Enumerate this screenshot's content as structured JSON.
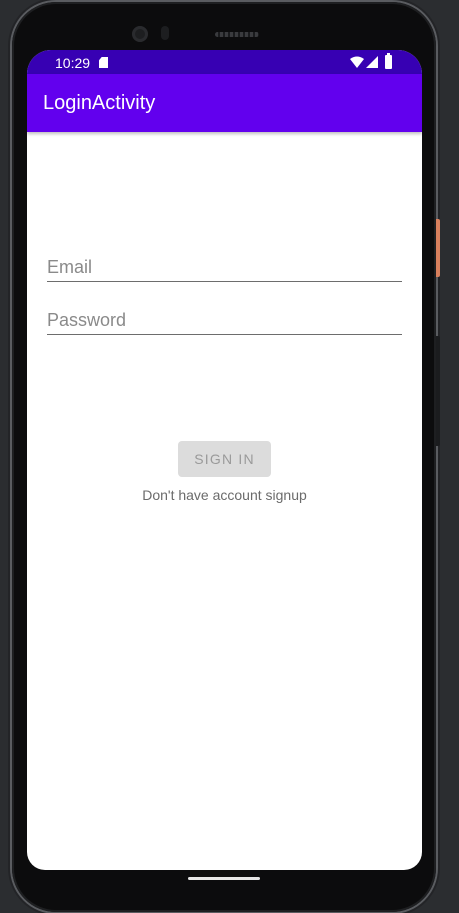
{
  "status_bar": {
    "time": "10:29"
  },
  "app_bar": {
    "title": "LoginActivity"
  },
  "form": {
    "email_placeholder": "Email",
    "email_value": "",
    "password_placeholder": "Password",
    "password_value": "",
    "sign_in_label": "SIGN IN",
    "signup_text": "Don't have account signup"
  },
  "colors": {
    "status_bar": "#3700b3",
    "app_bar": "#6200ee",
    "button_disabled": "#dcdcdc"
  }
}
